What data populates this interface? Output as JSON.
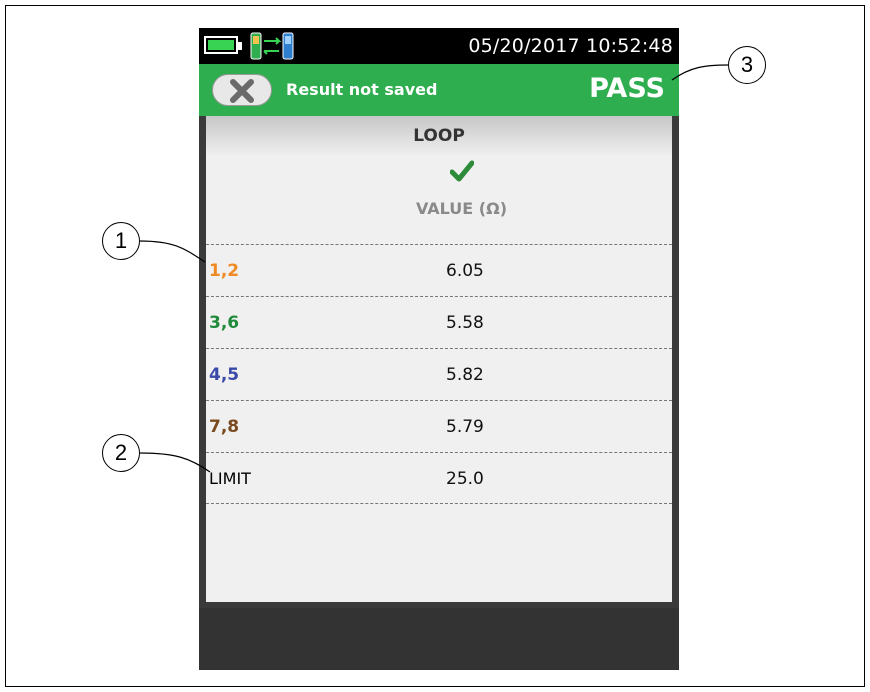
{
  "status_bar": {
    "datetime": "05/20/2017 10:52:48",
    "battery_icon": "battery-full-icon",
    "link_icon": "remote-link-icon"
  },
  "header": {
    "close_icon": "close-x-icon",
    "save_status": "Result not saved",
    "result": "PASS"
  },
  "content": {
    "measurement_title": "LOOP",
    "status_icon": "check-icon",
    "value_header": "VALUE (Ω)",
    "rows": [
      {
        "pair": "1,2",
        "value": "6.05",
        "color": "#f08a24"
      },
      {
        "pair": "3,6",
        "value": "5.58",
        "color": "#1e8a3a"
      },
      {
        "pair": "4,5",
        "value": "5.82",
        "color": "#3a4aa8"
      },
      {
        "pair": "7,8",
        "value": "5.79",
        "color": "#7a4a1e"
      }
    ],
    "limit": {
      "label": "LIMIT",
      "value": "25.0"
    }
  },
  "callouts": [
    "1",
    "2",
    "3"
  ],
  "colors": {
    "header_green": "#2fae4f",
    "check_green": "#2e8b3a"
  }
}
